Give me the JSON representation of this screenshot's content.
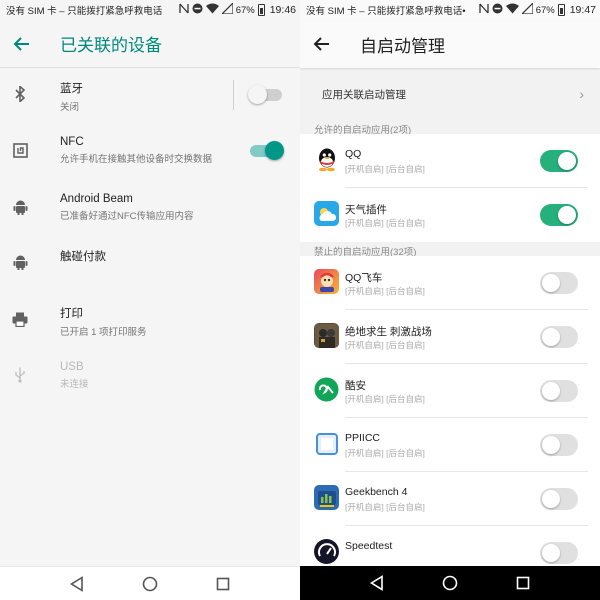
{
  "left": {
    "status": {
      "carrier": "没有 SIM 卡 – 只能拨打紧急呼救电话",
      "battery": "67%",
      "time": "19:46"
    },
    "title": "已关联的设备",
    "items": [
      {
        "label": "蓝牙",
        "sub": "关闭",
        "icon": "bluetooth-icon",
        "toggle": "off"
      },
      {
        "label": "NFC",
        "sub": "允许手机在接触其他设备时交换数据",
        "icon": "nfc-icon",
        "toggle": "on"
      },
      {
        "label": "Android Beam",
        "sub": "已准备好通过NFC传输应用内容",
        "icon": "android-icon"
      },
      {
        "label": "触碰付款",
        "sub": "",
        "icon": "android-icon"
      },
      {
        "label": "打印",
        "sub": "已开启 1 项打印服务",
        "icon": "printer-icon"
      },
      {
        "label": "USB",
        "sub": "未连接",
        "icon": "usb-icon",
        "disabled": true
      }
    ]
  },
  "right": {
    "status": {
      "carrier": "没有 SIM 卡 – 只能拨打紧急呼救电话•",
      "battery": "67%",
      "time": "19:47"
    },
    "title": "自启动管理",
    "link_label": "应用关联启动管理",
    "allowed_header": "允许的自启动应用(2项)",
    "denied_header": "禁止的自启动应用(32项)",
    "sub_text": "[开机自启] [后台自启]",
    "apps": [
      {
        "name": "QQ",
        "enabled": true,
        "icon": "qq-icon",
        "color": "#ffffff"
      },
      {
        "name": "天气插件",
        "enabled": true,
        "icon": "weather-icon",
        "color": "#29a8e8"
      },
      {
        "name": "QQ飞车",
        "enabled": false,
        "icon": "qq-speed-icon",
        "color": "#e84a5f"
      },
      {
        "name": "绝地求生 刺激战场",
        "enabled": false,
        "icon": "pubg-icon",
        "color": "#5a4a3a"
      },
      {
        "name": "酷安",
        "enabled": false,
        "icon": "coolapk-icon",
        "color": "#11a55a"
      },
      {
        "name": "PPIICC",
        "enabled": false,
        "icon": "ppiicc-icon",
        "color": "#4a90d9"
      },
      {
        "name": "Geekbench 4",
        "enabled": false,
        "icon": "geekbench-icon",
        "color": "#2e6bb5"
      },
      {
        "name": "Speedtest",
        "enabled": false,
        "icon": "speedtest-icon",
        "color": "#141526"
      }
    ]
  },
  "colors": {
    "accent_left": "#00897b",
    "toggle_on_right": "#26b07b"
  }
}
